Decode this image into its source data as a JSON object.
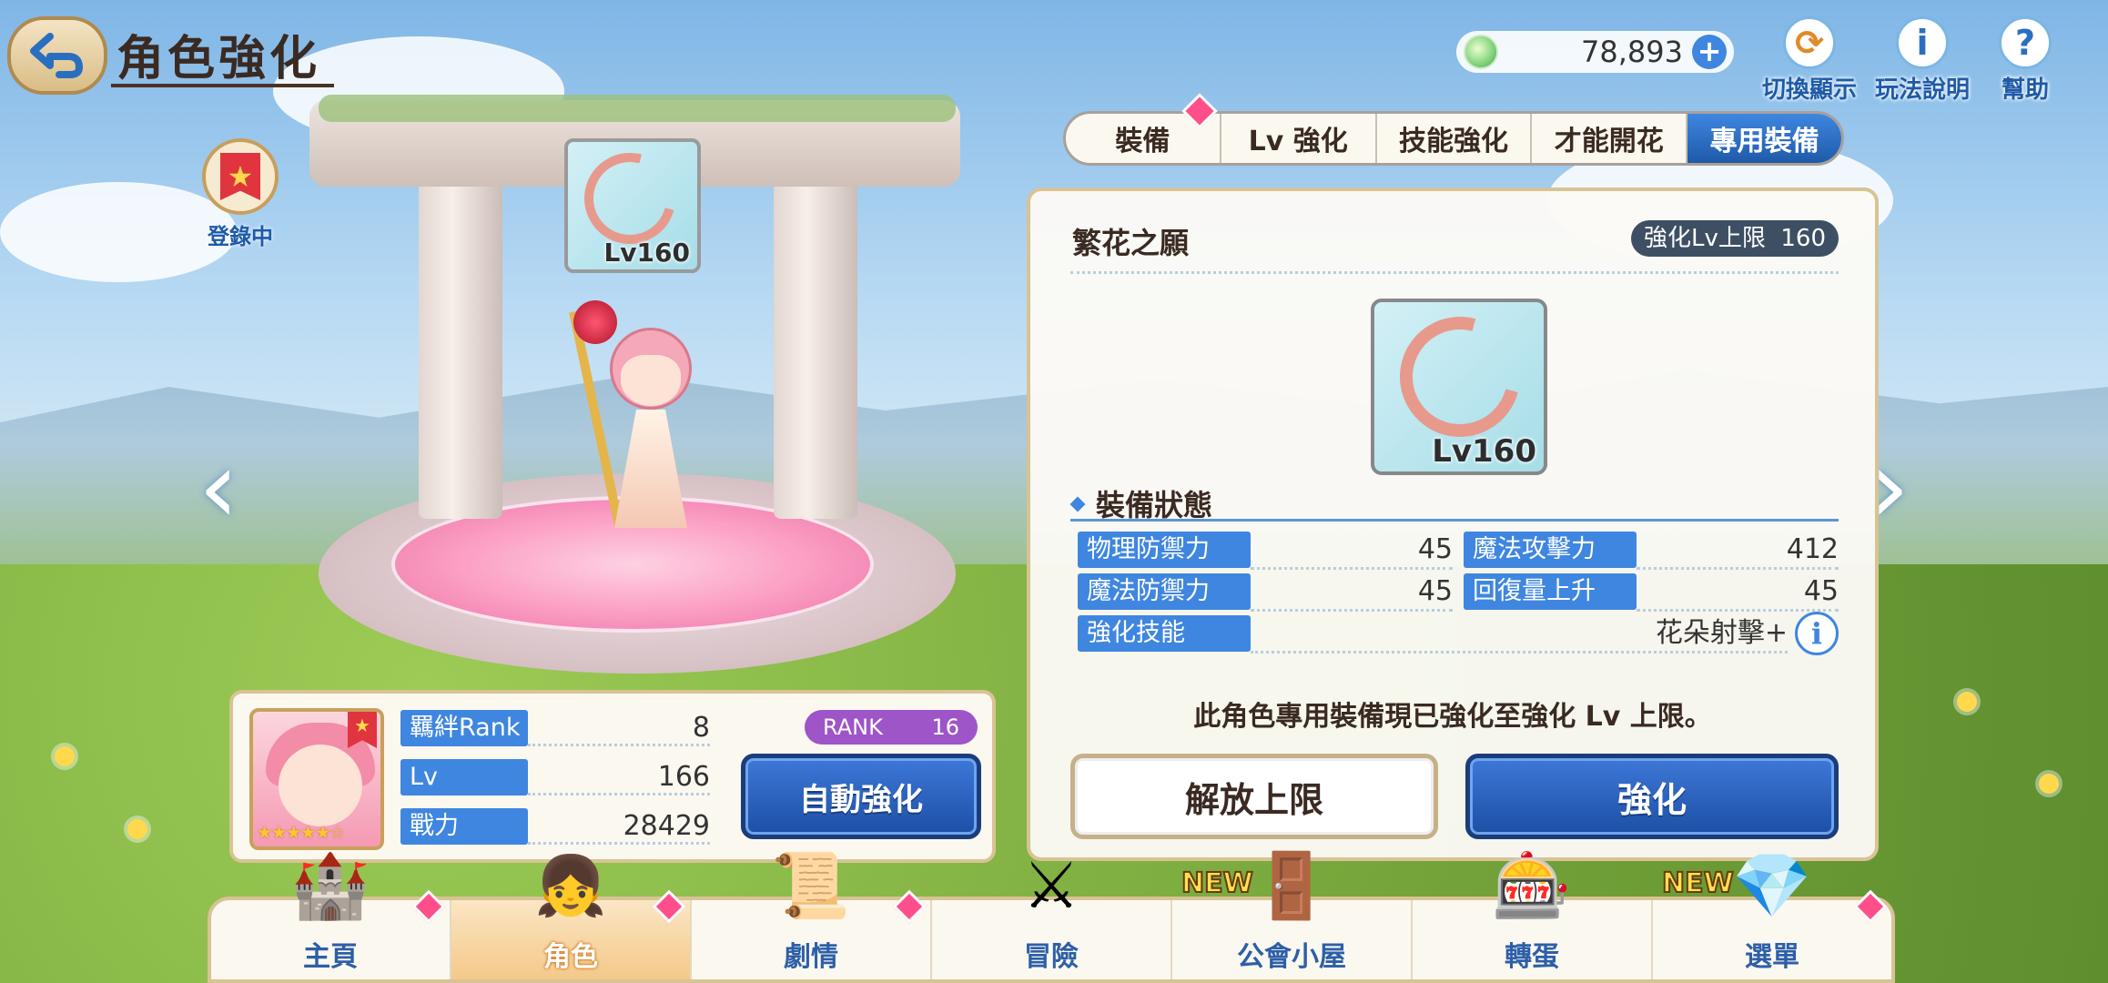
{
  "header": {
    "title": "角色強化",
    "currency_value": "78,893"
  },
  "top_icons": [
    {
      "label": "切換顯示",
      "icon": "character-swap-icon"
    },
    {
      "label": "玩法說明",
      "icon": "info-icon"
    },
    {
      "label": "幫助",
      "icon": "help-icon"
    }
  ],
  "registered_badge": "登錄中",
  "equip_thumb_level": "Lv160",
  "char_panel": {
    "stats": [
      {
        "label": "羈絆Rank",
        "value": "8"
      },
      {
        "label": "Lv",
        "value": "166"
      },
      {
        "label": "戰力",
        "value": "28429"
      }
    ],
    "rank_label": "RANK",
    "rank_value": "16",
    "auto_button": "自動強化"
  },
  "tabs": [
    "裝備",
    "Lv 強化",
    "技能強化",
    "才能開花",
    "專用裝備"
  ],
  "active_tab": "專用裝備",
  "detail": {
    "equip_name": "繁花之願",
    "limit_label": "強化Lv上限",
    "limit_value": "160",
    "equip_level": "Lv160",
    "section_title": "裝備狀態",
    "attributes_left": [
      {
        "label": "物理防禦力",
        "value": "45"
      },
      {
        "label": "魔法防禦力",
        "value": "45"
      }
    ],
    "attributes_right": [
      {
        "label": "魔法攻擊力",
        "value": "412"
      },
      {
        "label": "回復量上升",
        "value": "45"
      }
    ],
    "skill_label": "強化技能",
    "skill_value": "花朵射擊+",
    "max_message": "此角色專用裝備現已強化至強化 Lv 上限。",
    "release_button": "解放上限",
    "enhance_button": "強化"
  },
  "bottom_nav": [
    {
      "label": "主頁",
      "icon": "castle-icon",
      "badge": true,
      "new": ""
    },
    {
      "label": "角色",
      "icon": "character-icon",
      "badge": true,
      "new": "",
      "active": true
    },
    {
      "label": "劇情",
      "icon": "scroll-icon",
      "badge": true,
      "new": ""
    },
    {
      "label": "冒險",
      "icon": "flag-sword-icon",
      "badge": false,
      "new": ""
    },
    {
      "label": "公會小屋",
      "icon": "house-door-icon",
      "badge": false,
      "new": "NEW"
    },
    {
      "label": "轉蛋",
      "icon": "gacha-icon",
      "badge": false,
      "new": ""
    },
    {
      "label": "選單",
      "icon": "crystal-icon",
      "badge": true,
      "new": "NEW"
    }
  ],
  "colors": {
    "accent_blue": "#3f86e0",
    "badge_pink": "#ff4f8b",
    "rank_purple": "#9d55c8",
    "panel_border": "#d8c394"
  }
}
